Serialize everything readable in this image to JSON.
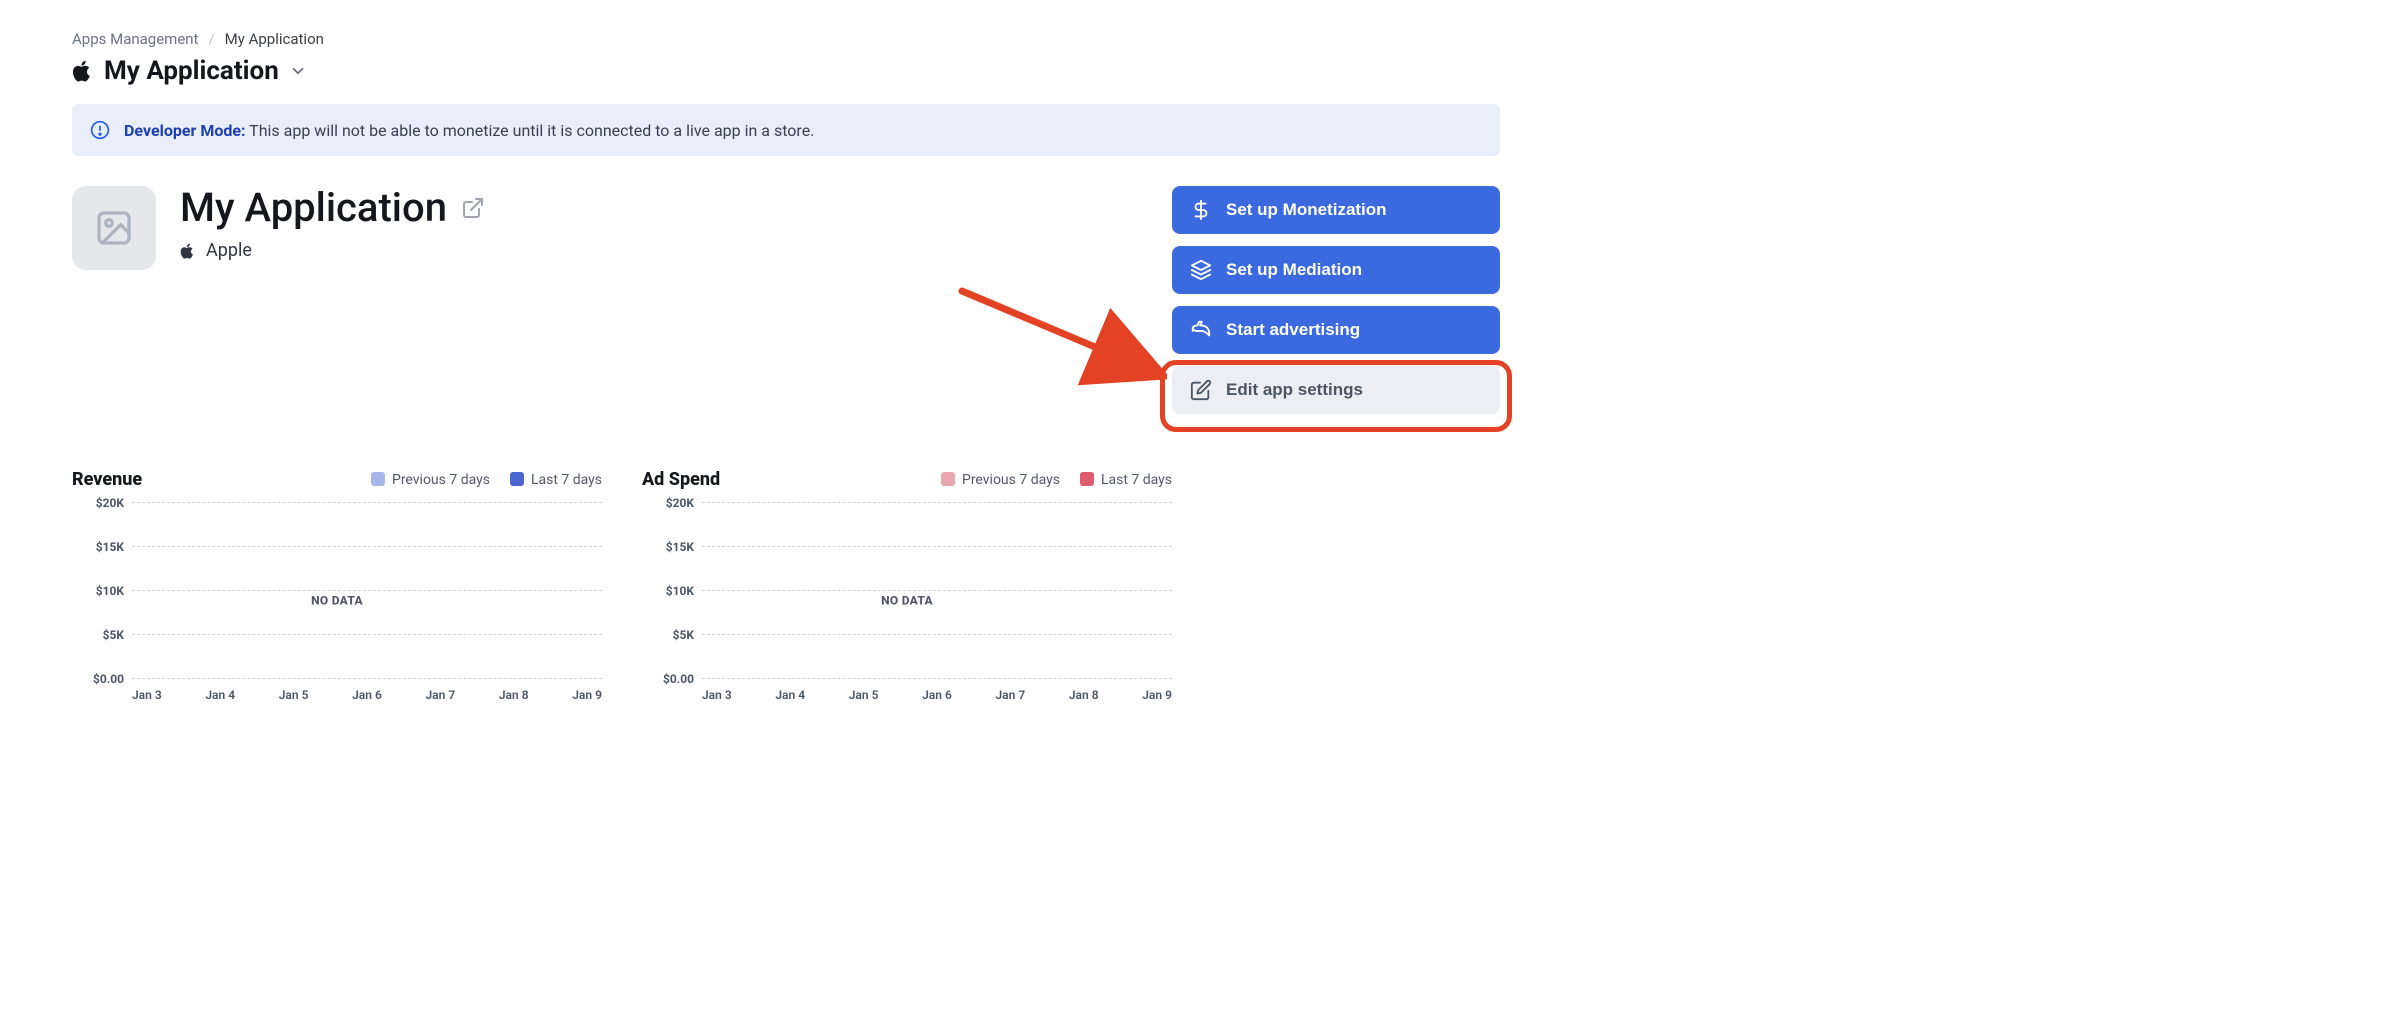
{
  "breadcrumb": {
    "root": "Apps Management",
    "current": "My Application"
  },
  "title": {
    "platform_icon": "apple-icon",
    "text": "My Application"
  },
  "banner": {
    "label": "Developer Mode:",
    "message": "This app will not be able to monetize until it is connected to a live app in a store."
  },
  "app": {
    "name": "My Application",
    "platform": "Apple"
  },
  "actions": [
    {
      "id": "monetization",
      "label": "Set up Monetization",
      "icon": "dollar-icon",
      "style": "primary"
    },
    {
      "id": "mediation",
      "label": "Set up Mediation",
      "icon": "layers-icon",
      "style": "primary"
    },
    {
      "id": "advertising",
      "label": "Start advertising",
      "icon": "megaphone-icon",
      "style": "primary"
    },
    {
      "id": "settings",
      "label": "Edit app settings",
      "icon": "edit-icon",
      "style": "secondary",
      "highlighted": true
    }
  ],
  "charts": {
    "revenue": {
      "title": "Revenue",
      "legend": {
        "prev": "Previous 7 days",
        "last": "Last 7 days",
        "prev_color": "#a9b6ea",
        "last_color": "#4c66d1"
      },
      "no_data_label": "NO DATA"
    },
    "adspend": {
      "title": "Ad Spend",
      "legend": {
        "prev": "Previous 7 days",
        "last": "Last 7 days",
        "prev_color": "#e9a8b0",
        "last_color": "#e05b6d"
      },
      "no_data_label": "NO DATA"
    }
  },
  "chart_data": [
    {
      "id": "revenue",
      "type": "line",
      "title": "Revenue",
      "series": [
        {
          "name": "Previous 7 days",
          "values": [
            null,
            null,
            null,
            null,
            null,
            null,
            null
          ]
        },
        {
          "name": "Last 7 days",
          "values": [
            null,
            null,
            null,
            null,
            null,
            null,
            null
          ]
        }
      ],
      "categories": [
        "Jan 3",
        "Jan 4",
        "Jan 5",
        "Jan 6",
        "Jan 7",
        "Jan 8",
        "Jan 9"
      ],
      "ylim": [
        "$0.00",
        "$5K",
        "$10K",
        "$15K",
        "$20K"
      ],
      "no_data": true
    },
    {
      "id": "adspend",
      "type": "line",
      "title": "Ad Spend",
      "series": [
        {
          "name": "Previous 7 days",
          "values": [
            null,
            null,
            null,
            null,
            null,
            null,
            null
          ]
        },
        {
          "name": "Last 7 days",
          "values": [
            null,
            null,
            null,
            null,
            null,
            null,
            null
          ]
        }
      ],
      "categories": [
        "Jan 3",
        "Jan 4",
        "Jan 5",
        "Jan 6",
        "Jan 7",
        "Jan 8",
        "Jan 9"
      ],
      "ylim": [
        "$0.00",
        "$5K",
        "$10K",
        "$15K",
        "$20K"
      ],
      "no_data": true
    }
  ]
}
